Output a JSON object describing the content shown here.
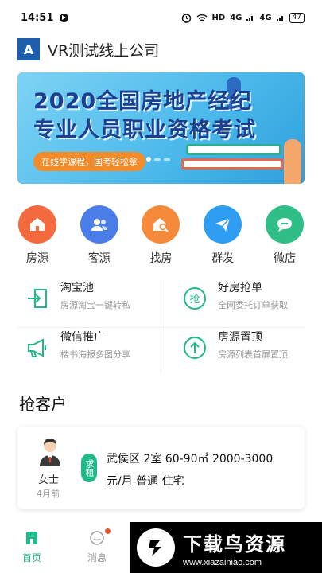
{
  "status_bar": {
    "time": "14:51",
    "network": "HD",
    "signal1": "4G",
    "signal2": "4G",
    "battery": "47"
  },
  "header": {
    "logo_letter": "A",
    "company_name": "VR测试线上公司"
  },
  "banner": {
    "line1": "2020全国房地产经纪",
    "line2": "专业人员职业资格考试",
    "tagline": "在线学课程，国考轻松拿"
  },
  "quick_actions": [
    {
      "label": "房源",
      "icon": "home-icon",
      "color": "#f26a3e"
    },
    {
      "label": "客源",
      "icon": "users-icon",
      "color": "#4a7de8"
    },
    {
      "label": "找房",
      "icon": "house-search-icon",
      "color": "#f58a3a"
    },
    {
      "label": "群发",
      "icon": "send-icon",
      "color": "#2f9ef2"
    },
    {
      "label": "微店",
      "icon": "chat-icon",
      "color": "#2fbf86"
    }
  ],
  "features": [
    {
      "title": "淘宝池",
      "subtitle": "房源淘宝一键转私",
      "icon": "import-icon"
    },
    {
      "title": "好房抢单",
      "subtitle": "全网委托订单获取",
      "icon": "grab-icon",
      "icon_text": "抢"
    },
    {
      "title": "微信推广",
      "subtitle": "楼书海报多图分享",
      "icon": "megaphone-icon"
    },
    {
      "title": "房源置顶",
      "subtitle": "房源列表首屏置顶",
      "icon": "arrow-up-icon"
    }
  ],
  "section": {
    "title": "抢客户"
  },
  "customer_card": {
    "gender": "女士",
    "time_ago": "4月前",
    "tag": "求租",
    "line1": "武侯区 2室 60-90㎡ 2000-3000",
    "line2": "元/月 普通 住宅"
  },
  "bottom_nav": [
    {
      "label": "首页",
      "icon": "home-tab-icon",
      "active": true
    },
    {
      "label": "消息",
      "icon": "message-tab-icon",
      "active": false
    }
  ],
  "watermark": {
    "title": "下载鸟资源",
    "url": "www.xiazainiao.com"
  },
  "colors": {
    "accent": "#21b98a",
    "primary": "#1d5fae"
  }
}
